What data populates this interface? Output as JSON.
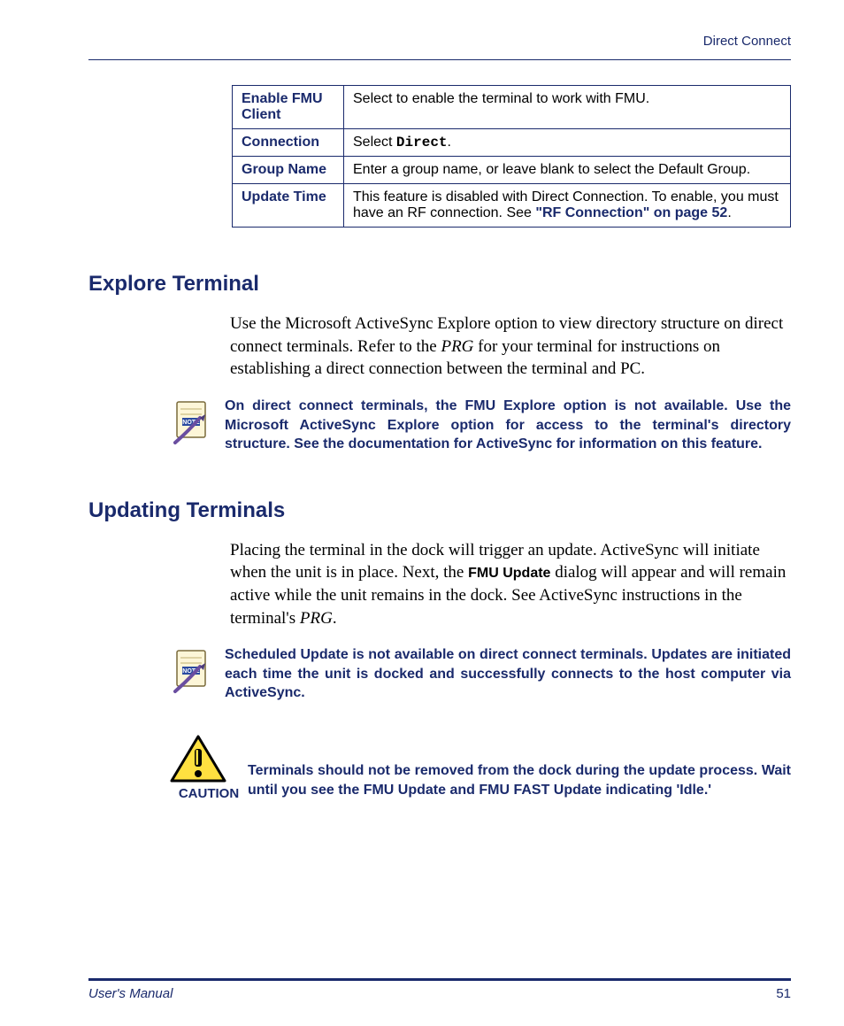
{
  "header": {
    "title": "Direct Connect"
  },
  "table": {
    "rows": [
      {
        "key": "Enable FMU Client",
        "value_pre": "Select to enable the terminal to work with FMU.",
        "value_mono": "",
        "value_post": ""
      },
      {
        "key": "Connection",
        "value_pre": "Select ",
        "value_mono": "Direct",
        "value_post": "."
      },
      {
        "key": "Group Name",
        "value_pre": "Enter a group name, or leave blank to select the Default Group.",
        "value_mono": "",
        "value_post": ""
      },
      {
        "key": "Update Time",
        "value_pre": "This feature is disabled with Direct Connection. To enable, you must have an RF connection. See ",
        "value_link": "\"RF Connection\" on page 52",
        "value_post": "."
      }
    ]
  },
  "sections": {
    "explore": {
      "title": "Explore Terminal",
      "para_pre": "Use the Microsoft ActiveSync Explore option to view directory structure on direct connect terminals. Refer to the ",
      "para_italic": "PRG",
      "para_post": " for your terminal for instructions on establishing a direct connection between the terminal and PC.",
      "note": "On direct connect terminals, the FMU Explore option is not available. Use the Microsoft ActiveSync Explore option for access to the terminal's directory structure. See the documentation for ActiveSync for information on this feature."
    },
    "updating": {
      "title": "Updating Terminals",
      "para_pre": "Placing the terminal in the dock will trigger an update. ActiveSync will initiate when the unit is in place. Next, the ",
      "para_bold": "FMU Update",
      "para_mid": " dialog will appear and will remain active while the unit remains in the dock. See ActiveSync instructions in the terminal's ",
      "para_italic": "PRG",
      "para_post": ".",
      "note": "Scheduled Update is not available on direct connect terminals. Updates are initiated each time the unit is docked and successfully connects to the host computer via ActiveSync.",
      "caution_label": "CAUTION",
      "caution": "Terminals should not be removed from the dock during the update process. Wait until you see the FMU Update and FMU FAST Update indicating 'Idle.'"
    }
  },
  "footer": {
    "left": "User's Manual",
    "right": "51"
  }
}
